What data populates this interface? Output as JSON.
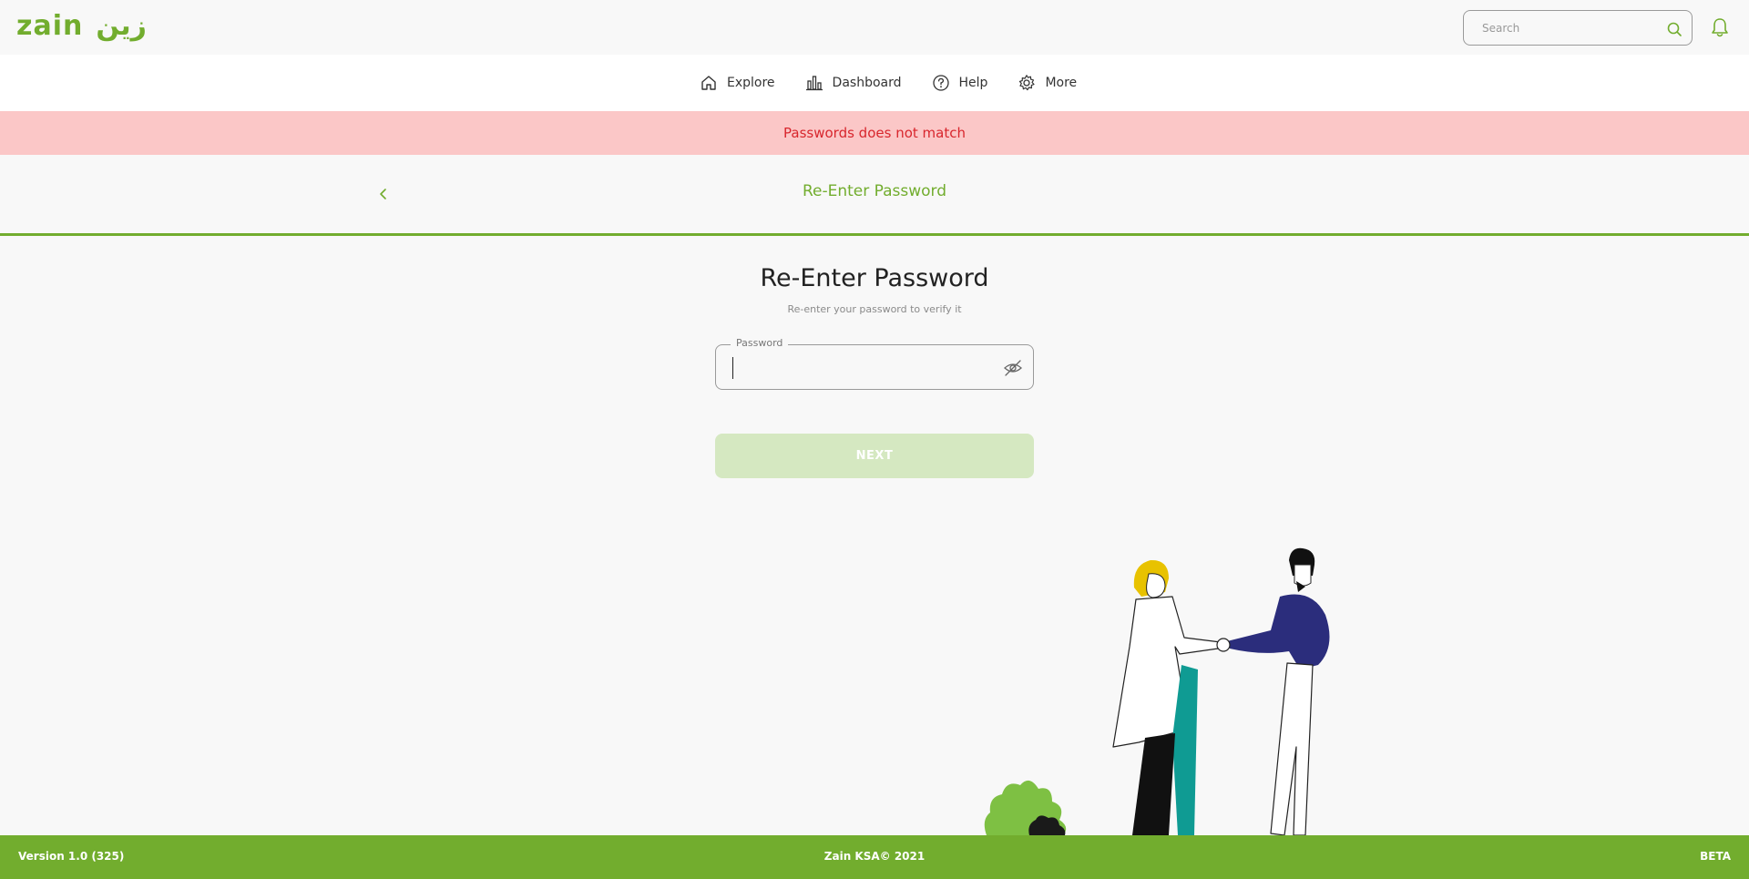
{
  "header": {
    "logo_latin": "zain",
    "logo_arabic": "زين",
    "search_placeholder": "Search"
  },
  "nav": {
    "items": [
      {
        "label": "Explore",
        "icon": "home-icon"
      },
      {
        "label": "Dashboard",
        "icon": "bar-chart-icon"
      },
      {
        "label": "Help",
        "icon": "help-circle-icon"
      },
      {
        "label": "More",
        "icon": "gear-icon"
      }
    ]
  },
  "alert": {
    "message": "Passwords does not match"
  },
  "step": {
    "title": "Re-Enter Password"
  },
  "form": {
    "heading": "Re-Enter Password",
    "subheading": "Re-enter your password to verify it",
    "password_label": "Password",
    "password_value": "",
    "next_label": "NEXT"
  },
  "footer": {
    "version": "Version 1.0 (325)",
    "copyright": "Zain KSA© 2021",
    "badge": "BETA"
  },
  "colors": {
    "brand_green": "#72ad2e",
    "alert_bg": "#fbc7c7",
    "alert_text": "#d8262d",
    "button_disabled": "#d5e8c1"
  }
}
